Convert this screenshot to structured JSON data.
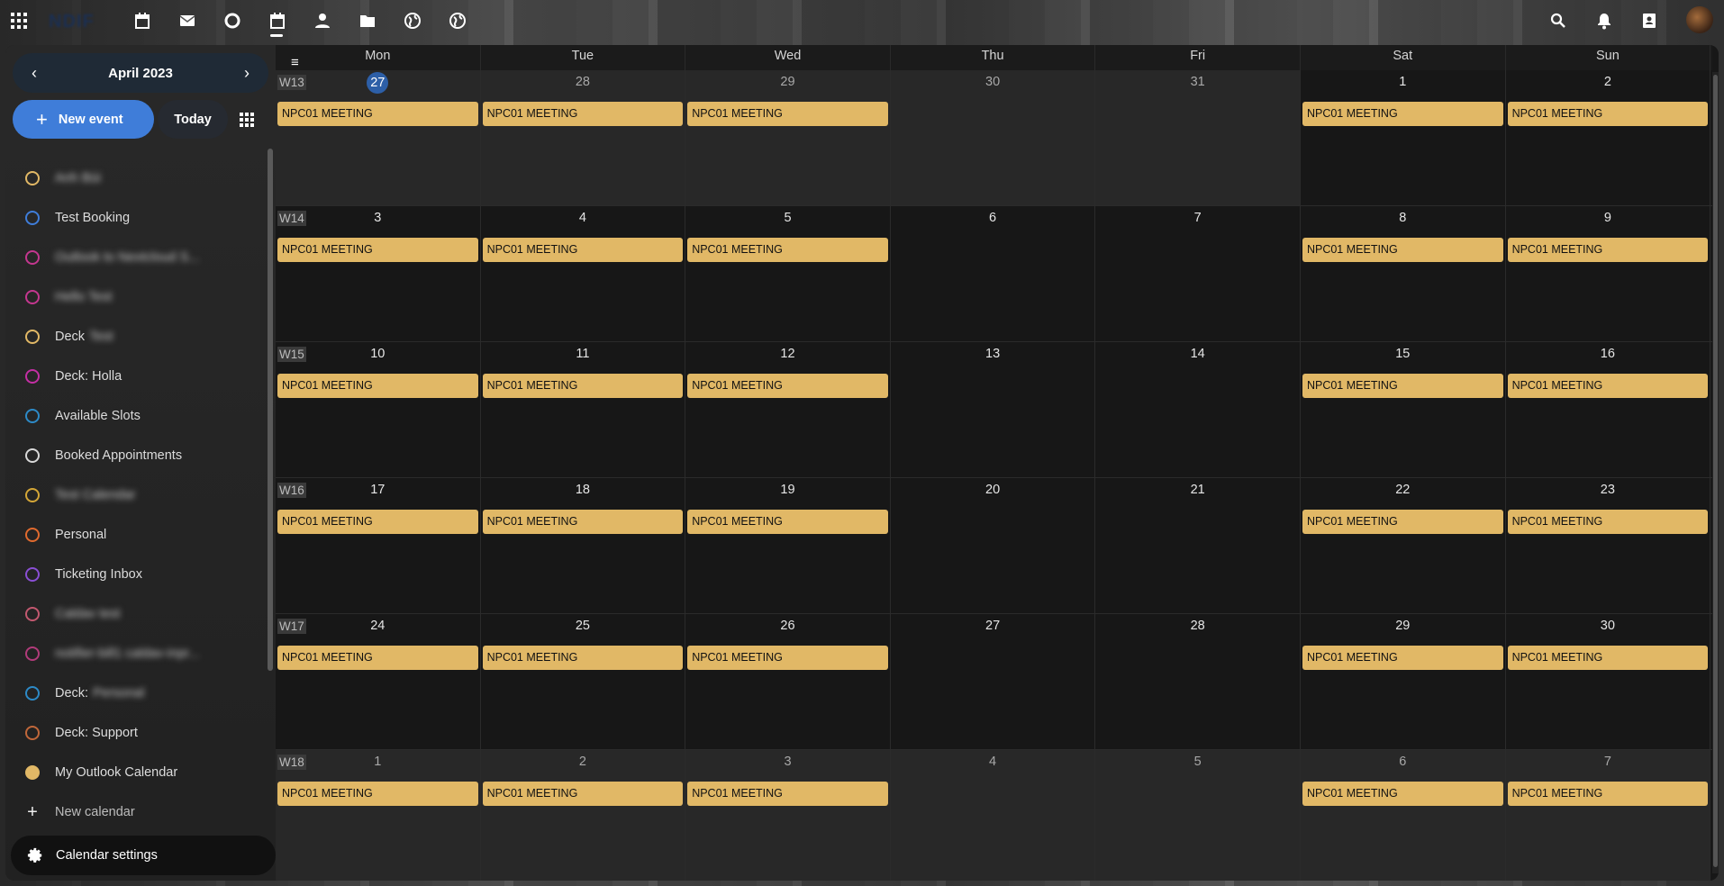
{
  "topbar": {
    "logo": "NDIF",
    "apps": [
      {
        "name": "apps-menu-icon"
      },
      {
        "name": "calendar-app-icon"
      },
      {
        "name": "mail-icon"
      },
      {
        "name": "circle-app-icon"
      },
      {
        "name": "calendar-active-icon"
      },
      {
        "name": "contacts-app-icon"
      },
      {
        "name": "folder-icon"
      },
      {
        "name": "globe-icon"
      },
      {
        "name": "globe-2-icon"
      }
    ],
    "right": [
      "search-icon",
      "bell-icon",
      "contacts-icon",
      "avatar"
    ]
  },
  "sidebar": {
    "month_label": "April 2023",
    "new_event_label": "New event",
    "today_label": "Today",
    "calendars": [
      {
        "label": "Anh Bùi",
        "color": "#e1b866",
        "blurred": true
      },
      {
        "label": "Test Booking",
        "color": "#3f7dd9",
        "blurred": false
      },
      {
        "label": "Outlook to Nextcloud S...",
        "color": "#c4378f",
        "blurred": true
      },
      {
        "label": "Hello Test",
        "color": "#c4378f",
        "blurred": true
      },
      {
        "label": "Deck",
        "suffix": "Test",
        "color": "#e1b866",
        "blurred": false
      },
      {
        "label": "Deck: Holla",
        "color": "#c42fa4",
        "blurred": false
      },
      {
        "label": "Available Slots",
        "color": "#2d8ac7",
        "blurred": false
      },
      {
        "label": "Booked Appointments",
        "color": "#d8d8d8",
        "blurred": false
      },
      {
        "label": "Test Calendar",
        "color": "#d4a637",
        "blurred": true
      },
      {
        "label": "Personal",
        "color": "#e06a2e",
        "blurred": false
      },
      {
        "label": "Ticketing Inbox",
        "color": "#8a4fd4",
        "blurred": false
      },
      {
        "label": "Caldav test",
        "color": "#c2586f",
        "blurred": true
      },
      {
        "label": "notifier-bill1 caldav-inpr...",
        "color": "#b13b7a",
        "blurred": true
      },
      {
        "label": "Deck:",
        "suffix": "Personal",
        "color": "#2d8ac7",
        "blurred": false
      },
      {
        "label": "Deck: Support",
        "color": "#c0673a",
        "blurred": false
      },
      {
        "label": "My Outlook Calendar",
        "color": "#e1b866",
        "blurred": false,
        "filled": true
      }
    ],
    "new_calendar_label": "New calendar",
    "settings_label": "Calendar settings"
  },
  "calendar": {
    "weekdays": [
      "Mon",
      "Tue",
      "Wed",
      "Thu",
      "Fri",
      "Sat",
      "Sun"
    ],
    "event_color": "#e1b866",
    "weeks": [
      {
        "label": "W13",
        "days": [
          {
            "n": "27",
            "other": true,
            "today": true,
            "event": "NPC01 MEETING"
          },
          {
            "n": "28",
            "other": true,
            "event": "NPC01 MEETING"
          },
          {
            "n": "29",
            "other": true,
            "event": "NPC01 MEETING"
          },
          {
            "n": "30",
            "other": true,
            "event": ""
          },
          {
            "n": "31",
            "other": true,
            "event": ""
          },
          {
            "n": "1",
            "other": false,
            "event": "NPC01 MEETING"
          },
          {
            "n": "2",
            "other": false,
            "event": "NPC01 MEETING"
          }
        ]
      },
      {
        "label": "W14",
        "days": [
          {
            "n": "3",
            "event": "NPC01 MEETING"
          },
          {
            "n": "4",
            "event": "NPC01 MEETING"
          },
          {
            "n": "5",
            "event": "NPC01 MEETING"
          },
          {
            "n": "6",
            "event": ""
          },
          {
            "n": "7",
            "event": ""
          },
          {
            "n": "8",
            "event": "NPC01 MEETING"
          },
          {
            "n": "9",
            "event": "NPC01 MEETING"
          }
        ]
      },
      {
        "label": "W15",
        "days": [
          {
            "n": "10",
            "event": "NPC01 MEETING"
          },
          {
            "n": "11",
            "event": "NPC01 MEETING"
          },
          {
            "n": "12",
            "event": "NPC01 MEETING"
          },
          {
            "n": "13",
            "event": ""
          },
          {
            "n": "14",
            "event": ""
          },
          {
            "n": "15",
            "event": "NPC01 MEETING"
          },
          {
            "n": "16",
            "event": "NPC01 MEETING"
          }
        ]
      },
      {
        "label": "W16",
        "days": [
          {
            "n": "17",
            "event": "NPC01 MEETING"
          },
          {
            "n": "18",
            "event": "NPC01 MEETING"
          },
          {
            "n": "19",
            "event": "NPC01 MEETING"
          },
          {
            "n": "20",
            "event": ""
          },
          {
            "n": "21",
            "event": ""
          },
          {
            "n": "22",
            "event": "NPC01 MEETING"
          },
          {
            "n": "23",
            "event": "NPC01 MEETING"
          }
        ]
      },
      {
        "label": "W17",
        "days": [
          {
            "n": "24",
            "event": "NPC01 MEETING"
          },
          {
            "n": "25",
            "event": "NPC01 MEETING"
          },
          {
            "n": "26",
            "event": "NPC01 MEETING"
          },
          {
            "n": "27",
            "event": ""
          },
          {
            "n": "28",
            "event": ""
          },
          {
            "n": "29",
            "event": "NPC01 MEETING"
          },
          {
            "n": "30",
            "event": "NPC01 MEETING"
          }
        ]
      },
      {
        "label": "W18",
        "days": [
          {
            "n": "1",
            "other": true,
            "event": "NPC01 MEETING"
          },
          {
            "n": "2",
            "other": true,
            "event": "NPC01 MEETING"
          },
          {
            "n": "3",
            "other": true,
            "event": "NPC01 MEETING"
          },
          {
            "n": "4",
            "other": true,
            "event": ""
          },
          {
            "n": "5",
            "other": true,
            "event": ""
          },
          {
            "n": "6",
            "other": true,
            "event": "NPC01 MEETING"
          },
          {
            "n": "7",
            "other": true,
            "event": "NPC01 MEETING"
          }
        ]
      }
    ]
  }
}
